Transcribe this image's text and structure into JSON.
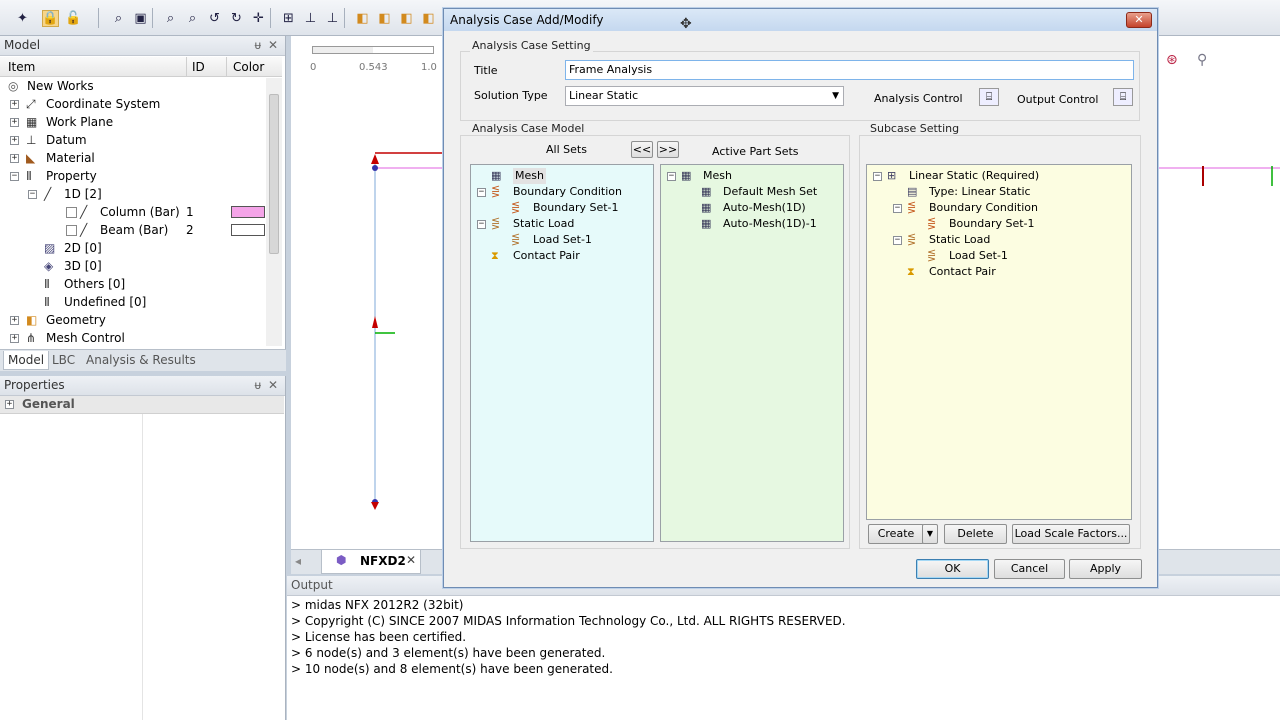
{
  "colors": {
    "accent": "#3c7fb1",
    "column_swatch": "#f4a4e8",
    "beam_swatch": "#ffffff",
    "allsets_bg": "#e6fafa",
    "active_bg": "#e6f8e1",
    "subcase_bg": "#fcfde1"
  },
  "model_panel": {
    "title": "Model",
    "col_item": "Item",
    "col_id": "ID",
    "col_color": "Color",
    "tree": [
      {
        "label": "New Works"
      },
      {
        "label": "Coordinate System"
      },
      {
        "label": "Work Plane"
      },
      {
        "label": "Datum"
      },
      {
        "label": "Material"
      },
      {
        "label": "Property"
      },
      {
        "label": "1D [2]"
      },
      {
        "label": "Column (Bar)",
        "id": "1"
      },
      {
        "label": "Beam (Bar)",
        "id": "2"
      },
      {
        "label": "2D [0]"
      },
      {
        "label": "3D [0]"
      },
      {
        "label": "Others [0]"
      },
      {
        "label": "Undefined [0]"
      },
      {
        "label": "Geometry"
      },
      {
        "label": "Mesh Control"
      }
    ],
    "tabs": [
      "Model",
      "LBC",
      "Analysis & Results"
    ]
  },
  "properties_panel": {
    "title": "Properties",
    "group": "General"
  },
  "viewport": {
    "ruler": [
      "0",
      "0.543",
      "1.0"
    ],
    "tab_label": "NFXD2"
  },
  "output": {
    "title": "Output",
    "lines": [
      "> midas NFX 2012R2 (32bit)",
      "> Copyright (C) SINCE 2007 MIDAS Information Technology Co., Ltd. ALL RIGHTS RESERVED.",
      "> License has been certified.",
      "> 6 node(s) and 3 element(s) have been generated.",
      "> 10 node(s) and 8 element(s) have been generated."
    ]
  },
  "dialog": {
    "title": "Analysis Case Add/Modify",
    "setting_group": "Analysis Case Setting",
    "title_label": "Title",
    "title_value": "Frame Analysis",
    "solution_label": "Solution Type",
    "solution_value": "Linear Static",
    "analysis_control": "Analysis Control",
    "output_control": "Output Control",
    "model_group": "Analysis Case Model",
    "all_sets": "All Sets",
    "active_sets": "Active Part Sets",
    "move_left": "<<",
    "move_right": ">>",
    "all_tree": [
      "Mesh",
      "Boundary Condition",
      "Boundary Set-1",
      "Static Load",
      "Load Set-1",
      "Contact Pair"
    ],
    "active_tree": [
      "Mesh",
      "Default Mesh Set",
      "Auto-Mesh(1D)",
      "Auto-Mesh(1D)-1"
    ],
    "subcase_group": "Subcase Setting",
    "subcase_tree": [
      "Linear Static (Required)",
      "Type: Linear Static",
      "Boundary Condition",
      "Boundary Set-1",
      "Static Load",
      "Load Set-1",
      "Contact Pair"
    ],
    "create": "Create",
    "delete": "Delete",
    "load_scale": "Load Scale Factors...",
    "ok": "OK",
    "cancel": "Cancel",
    "apply": "Apply"
  }
}
